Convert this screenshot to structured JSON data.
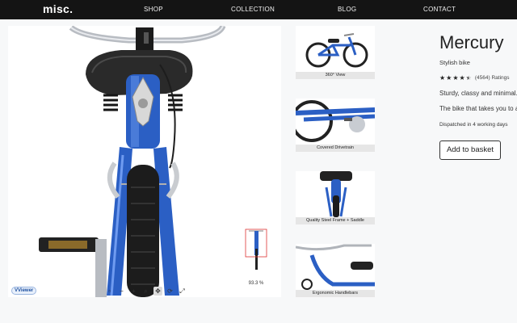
{
  "header": {
    "logo": "misc.",
    "nav": [
      {
        "label": "SHOP"
      },
      {
        "label": "COLLECTION"
      },
      {
        "label": "BLOG"
      },
      {
        "label": "CONTACT"
      }
    ]
  },
  "viewer": {
    "badge": "VViewer",
    "zoom_label": "93.3 %",
    "toolbar_icons": [
      "reset-icon",
      "zoom-out-icon",
      "zoom-in-icon",
      "magnifier-icon",
      "pan-icon",
      "rotate-icon",
      "fullscreen-icon"
    ],
    "toolbar_glyphs": [
      "▫",
      "−",
      "+",
      "⌕",
      "✥",
      "⟳",
      "⤢"
    ],
    "accent_color": "#2b5fc4"
  },
  "thumbnails": [
    {
      "caption": "360° View"
    },
    {
      "caption": "Covered Drivetrain"
    },
    {
      "caption": "Quality Steel Frame + Saddle"
    },
    {
      "caption": "Ergonomic Handlebars"
    }
  ],
  "product": {
    "title": "Mercury",
    "subtitle": "Stylish bike",
    "rating_value": 4.5,
    "rating_count": "(4564) Ratings",
    "description_1": "Sturdy, classy and minimal.",
    "description_2": "The bike that takes you to all",
    "dispatch": "Dispatched in 4 working days",
    "add_button": "Add to basket"
  }
}
